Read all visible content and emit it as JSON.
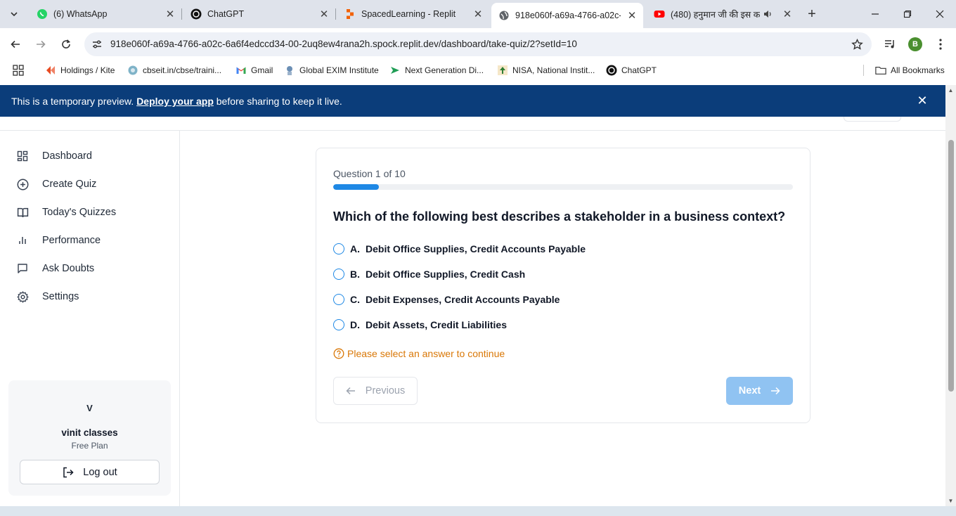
{
  "browser": {
    "tabs": [
      {
        "label": "(6) WhatsApp",
        "icon": "whatsapp-icon"
      },
      {
        "label": "ChatGPT",
        "icon": "chatgpt-icon"
      },
      {
        "label": "SpacedLearning - Replit",
        "icon": "replit-icon"
      },
      {
        "label": "918e060f-a69a-4766-a02c-6",
        "icon": "globe-icon",
        "active": true
      },
      {
        "label": "(480) हनुमान जी की इस क",
        "icon": "youtube-icon"
      }
    ],
    "url": "918e060f-a69a-4766-a02c-6a6f4edccd34-00-2uq8ew4rana2h.spock.replit.dev/dashboard/take-quiz/2?setId=10",
    "profile_initial": "B",
    "bookmarks": [
      {
        "label": "Holdings / Kite",
        "icon": "kite-icon"
      },
      {
        "label": "cbseit.in/cbse/traini...",
        "icon": "cbse-icon"
      },
      {
        "label": "Gmail",
        "icon": "gmail-icon"
      },
      {
        "label": "Global EXIM Institute",
        "icon": "exim-icon"
      },
      {
        "label": "Next Generation Di...",
        "icon": "arrow-icon"
      },
      {
        "label": "NISA, National Instit...",
        "icon": "nisa-icon"
      },
      {
        "label": "ChatGPT",
        "icon": "chatgpt-icon"
      }
    ],
    "all_bookmarks_label": "All Bookmarks"
  },
  "banner": {
    "prefix": "This is a temporary preview.",
    "link": "Deploy your app",
    "suffix": "before sharing to keep it live."
  },
  "sidebar": {
    "items": [
      {
        "label": "Dashboard",
        "icon": "dashboard-icon"
      },
      {
        "label": "Create Quiz",
        "icon": "plus-circle-icon"
      },
      {
        "label": "Today's Quizzes",
        "icon": "book-open-icon"
      },
      {
        "label": "Performance",
        "icon": "bar-chart-icon"
      },
      {
        "label": "Ask Doubts",
        "icon": "message-icon"
      },
      {
        "label": "Settings",
        "icon": "gear-icon"
      }
    ],
    "user": {
      "initial": "V",
      "name": "vinit classes",
      "plan": "Free Plan",
      "logout_label": "Log out"
    }
  },
  "quiz": {
    "counter": "Question 1 of 10",
    "progress": 0.1,
    "question": "Which of the following best describes a stakeholder in a business context?",
    "options": [
      {
        "letter": "A.",
        "text": "Debit Office Supplies, Credit Accounts Payable"
      },
      {
        "letter": "B.",
        "text": "Debit Office Supplies, Credit Cash"
      },
      {
        "letter": "C.",
        "text": "Debit Expenses, Credit Accounts Payable"
      },
      {
        "letter": "D.",
        "text": "Debit Assets, Credit Liabilities"
      }
    ],
    "hint": "Please select an answer to continue",
    "previous_label": "Previous",
    "next_label": "Next"
  },
  "colors": {
    "accent": "#1e88e5",
    "banner": "#0b3d7a",
    "warning": "#d97706",
    "next_disabled": "#90c3f2"
  }
}
